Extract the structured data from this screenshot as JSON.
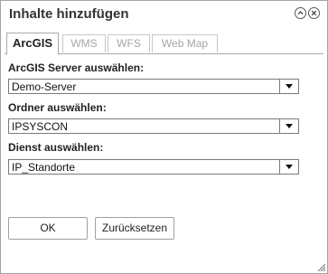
{
  "dialog": {
    "title": "Inhalte hinzufügen"
  },
  "tabs": [
    {
      "label": "ArcGIS",
      "active": true
    },
    {
      "label": "WMS",
      "active": false
    },
    {
      "label": "WFS",
      "active": false
    },
    {
      "label": "Web Map",
      "active": false
    }
  ],
  "fields": {
    "server": {
      "label": "ArcGIS Server auswählen:",
      "value": "Demo-Server"
    },
    "folder": {
      "label": "Ordner auswählen:",
      "value": "IPSYSCON"
    },
    "service": {
      "label": "Dienst auswählen:",
      "value": "IP_Standorte"
    }
  },
  "buttons": {
    "ok": "OK",
    "reset": "Zurücksetzen"
  },
  "icons": {
    "collapse": "chevron-up-icon",
    "close": "close-icon",
    "dropdown": "triangle-down-icon",
    "resize": "resize-grip-icon"
  }
}
